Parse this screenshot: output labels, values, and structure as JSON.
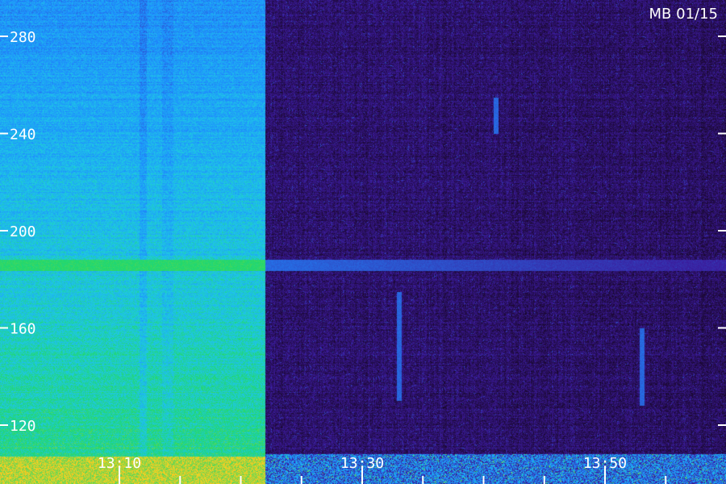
{
  "title": "MB 01/15",
  "chart_data": {
    "type": "heatmap",
    "title": "MB 01/15",
    "xlabel": "",
    "ylabel": "",
    "y_ticks": [
      "280",
      "240",
      "200",
      "160",
      "120"
    ],
    "y_values": [
      280,
      240,
      200,
      160,
      120
    ],
    "x_ticks": [
      "13:10",
      "13:30",
      "13:50"
    ],
    "y_range": [
      105,
      298
    ],
    "x_range": [
      "13:06",
      "13:58"
    ],
    "features": {
      "high_intensity_interval": [
        "13:06",
        "13:22"
      ],
      "horizontal_line_freq": 186,
      "vertical_bursts": [
        {
          "time": "13:33",
          "y_from": 130,
          "y_to": 175
        },
        {
          "time": "13:41",
          "y_from": 240,
          "y_to": 255
        },
        {
          "time": "13:53",
          "y_from": 128,
          "y_to": 160
        }
      ]
    },
    "colors": {
      "background": "#1a0830",
      "low": "#3b1a9a",
      "mid": "#1e8cff",
      "high": "#22d86a",
      "peak": "#ffd21f"
    }
  }
}
